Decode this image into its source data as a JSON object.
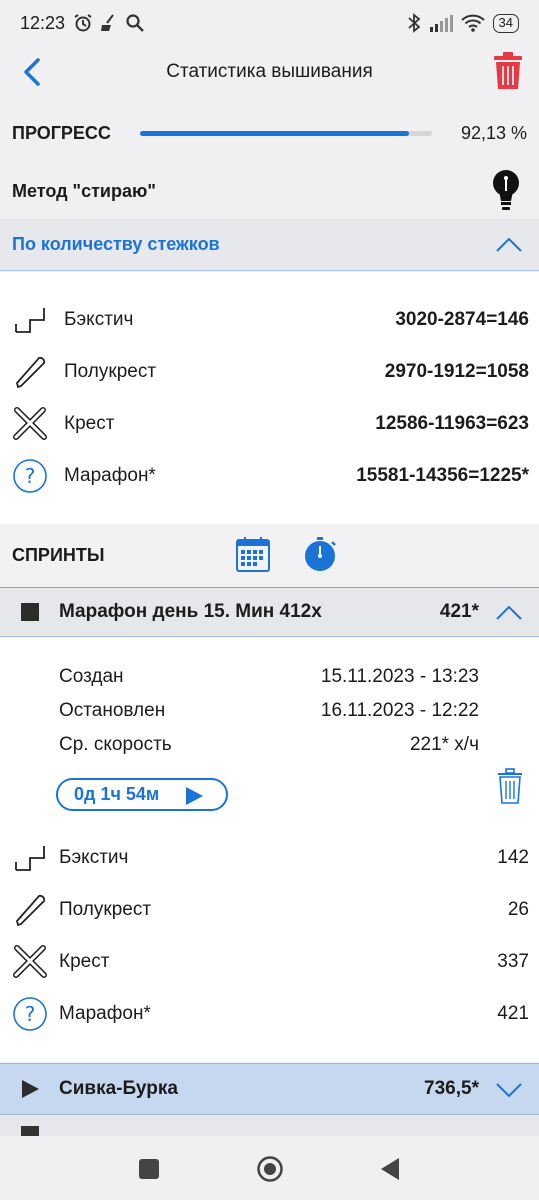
{
  "status_bar": {
    "time": "12:23",
    "battery": "34"
  },
  "app_bar": {
    "title": "Статистика вышивания"
  },
  "progress": {
    "label": "ПРОГРЕСС",
    "value_text": "92,13 %",
    "fraction": 0.9213
  },
  "method": {
    "label": "Метод \"стираю\""
  },
  "stitch_section": {
    "title": "По количеству стежков"
  },
  "stitch_rows": [
    {
      "name": "Бэкстич",
      "value": "3020-2874=146",
      "icon": "backstitch-icon"
    },
    {
      "name": "Полукрест",
      "value": "2970-1912=1058",
      "icon": "half-cross-icon"
    },
    {
      "name": "Крест",
      "value": "12586-11963=623",
      "icon": "cross-icon"
    },
    {
      "name": "Марафон*",
      "value": "15581-14356=1225*",
      "icon": "question-icon"
    }
  ],
  "sprints": {
    "label": "СПРИНТЫ",
    "sprint1": {
      "name": "Марафон день 15. Мин 412х",
      "count": "421*",
      "created_label": "Создан",
      "created_value": "15.11.2023 - 13:23",
      "stopped_label": "Остановлен",
      "stopped_value": "16.11.2023 - 12:22",
      "speed_label": "Ср. скорость",
      "speed_value": "221* х/ч",
      "timer": "0д 1ч 54м",
      "rows": [
        {
          "name": "Бэкстич",
          "value": "142"
        },
        {
          "name": "Полукрест",
          "value": "26"
        },
        {
          "name": "Крест",
          "value": "337"
        },
        {
          "name": "Марафон*",
          "value": "421"
        }
      ]
    },
    "sprint2": {
      "name": "Сивка-Бурка",
      "count": "736,5*"
    }
  },
  "colors": {
    "accent": "#1b73d8",
    "danger": "#e53945"
  }
}
